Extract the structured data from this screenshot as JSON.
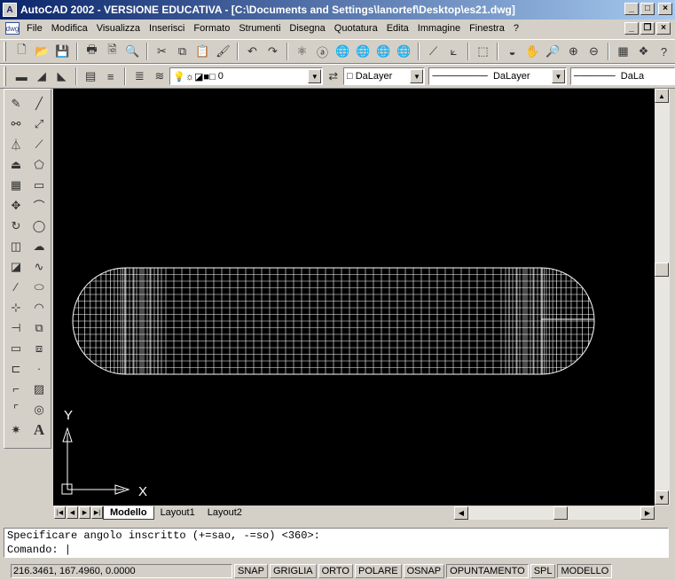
{
  "window": {
    "title": "AutoCAD 2002 - VERSIONE EDUCATIVA - [C:\\Documents and Settings\\lanortef\\Desktop\\es21.dwg]"
  },
  "menu": [
    "File",
    "Modifica",
    "Visualizza",
    "Inserisci",
    "Formato",
    "Strumenti",
    "Disegna",
    "Quotatura",
    "Edita",
    "Immagine",
    "Finestra",
    "?"
  ],
  "properties": {
    "layer_value": "0",
    "color_value": "DaLayer",
    "linetype_value": "DaLayer",
    "lineweight_value": "DaLa"
  },
  "ucs": {
    "x_label": "X",
    "y_label": "Y"
  },
  "layout_tabs": [
    "Modello",
    "Layout1",
    "Layout2"
  ],
  "active_tab": "Modello",
  "command": {
    "history": "Specificare angolo inscritto (+=sao, -=so) <360>:",
    "prompt": "Comando:"
  },
  "status": {
    "coords": "216.3461, 167.4960, 0.0000",
    "toggles": [
      "SNAP",
      "GRIGLIA",
      "ORTO",
      "POLARE",
      "OSNAP",
      "OPUNTAMENTO",
      "SPL",
      "MODELLO"
    ]
  },
  "icons": {
    "standard_toolbar": [
      "new-file-icon",
      "open-icon",
      "save-icon",
      "plot-icon",
      "preview-icon",
      "spell-icon",
      "cut-icon",
      "copy-icon",
      "paste-icon",
      "match-prop-icon",
      "undo-icon",
      "redo-icon",
      "hyperlink-icon",
      "today-icon",
      "web-icon",
      "pan-realtime-icon",
      "zoom-realtime-icon",
      "zoom-window-icon",
      "zoom-prev-icon",
      "properties-icon",
      "designcenter-icon",
      "help-icon"
    ],
    "draw_toolbar": [
      "line-icon",
      "construction-line-icon",
      "polyline-icon",
      "polygon-icon",
      "rectangle-icon",
      "arc-icon",
      "circle-icon",
      "revcloud-icon",
      "spline-icon",
      "ellipse-icon",
      "ellipse-arc-icon",
      "insert-block-icon",
      "make-block-icon",
      "point-icon",
      "hatch-icon",
      "region-icon",
      "mtext-icon"
    ],
    "modify_toolbar": [
      "erase-icon",
      "copy-object-icon",
      "mirror-icon",
      "offset-icon",
      "array-icon",
      "move-icon",
      "rotate-icon",
      "scale-icon",
      "stretch-icon",
      "trim-icon",
      "extend-icon",
      "break-icon",
      "chamfer-icon",
      "fillet-icon",
      "explode-icon"
    ]
  }
}
